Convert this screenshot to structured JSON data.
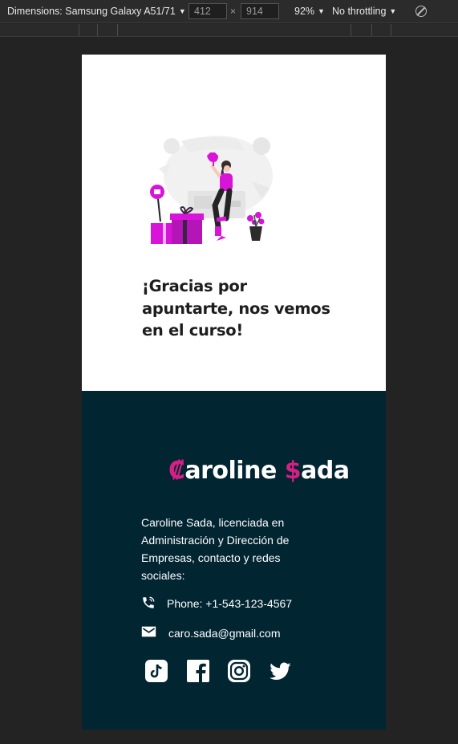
{
  "devtools": {
    "dimensions_label": "Dimensions: Samsung Galaxy A51/71",
    "width_value": "412",
    "height_value": "914",
    "zoom": "92%",
    "throttling": "No throttling"
  },
  "page": {
    "thanks_heading": "¡Gracias por apuntarte, nos vemos en el curso!",
    "footer": {
      "logo_initial_1": "₡",
      "logo_rest_1": "aroline ",
      "logo_initial_2": "$",
      "logo_rest_2": "ada",
      "description": "Caroline Sada, licenciada en Administración y Dirección de Empresas, contacto y redes sociales:",
      "phone": "Phone: +1-543-123-4567",
      "email": "caro.sada@gmail.com",
      "social_icons": [
        "tiktok-icon",
        "facebook-icon",
        "instagram-icon",
        "twitter-icon"
      ]
    }
  },
  "colors": {
    "footer_bg": "#022532",
    "accent": "#d61f82",
    "illustration_accent": "#d814d8"
  }
}
